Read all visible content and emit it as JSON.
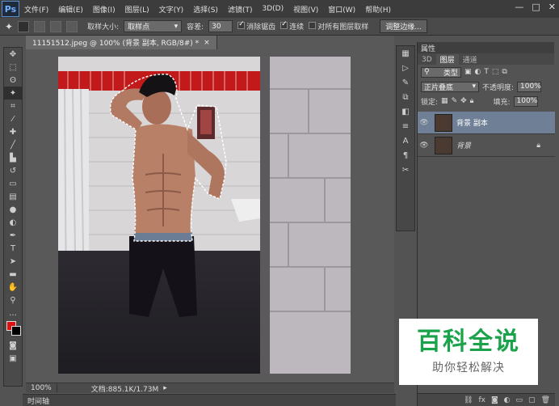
{
  "app": {
    "logo": "Ps"
  },
  "menu": [
    "文件(F)",
    "编辑(E)",
    "图像(I)",
    "图层(L)",
    "文字(Y)",
    "选择(S)",
    "滤镜(T)",
    "3D(D)",
    "视图(V)",
    "窗口(W)",
    "帮助(H)"
  ],
  "window_controls": {
    "minimize": "—",
    "maximize": "□",
    "close": "✕"
  },
  "options": {
    "sample_size_label": "取样大小:",
    "sample_size_value": "取样点",
    "tolerance_label": "容差:",
    "tolerance_value": "30",
    "antialias_label": "消除锯齿",
    "contiguous_label": "连续",
    "all_layers_label": "对所有图层取样",
    "refine_edge_label": "调整边缘..."
  },
  "document": {
    "tab_title": "11151512.jpeg @ 100% (背景 副本, RGB/8#) *",
    "tab_close": "×"
  },
  "status": {
    "zoom": "100%",
    "doc_size": "文档:885.1K/1.73M"
  },
  "timeline": {
    "label": "时间轴"
  },
  "panel": {
    "title": "属性",
    "tabs": [
      "3D",
      "图层",
      "通道"
    ],
    "filter_label": "类型",
    "blend_mode": "正片叠底",
    "opacity_label": "不透明度:",
    "opacity_value": "100%",
    "lock_label": "锁定:",
    "fill_label": "填充:",
    "fill_value": "100%",
    "layers": [
      {
        "name": "背景 副本",
        "selected": true
      },
      {
        "name": "背景",
        "selected": false
      }
    ]
  },
  "watermark": {
    "title": "百科全说",
    "subtitle": "助你轻松解决"
  },
  "icons": [
    "eye-icon",
    "lock-icon",
    "magic-wand-icon",
    "link-icon",
    "fx-icon",
    "trash-icon"
  ]
}
